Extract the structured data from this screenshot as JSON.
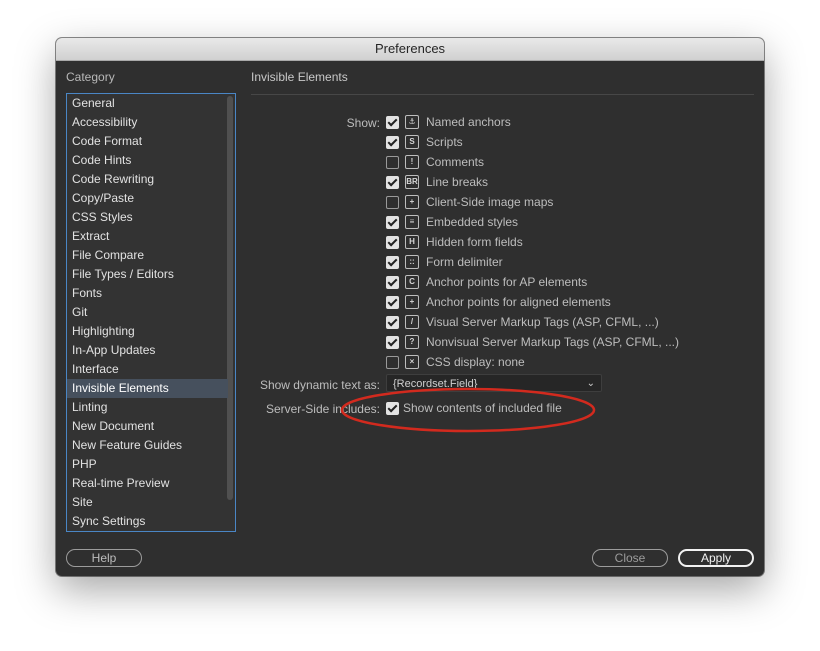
{
  "window": {
    "title": "Preferences"
  },
  "sidebar": {
    "heading": "Category",
    "items": [
      {
        "label": "General"
      },
      {
        "label": "Accessibility"
      },
      {
        "label": "Code Format"
      },
      {
        "label": "Code Hints"
      },
      {
        "label": "Code Rewriting"
      },
      {
        "label": "Copy/Paste"
      },
      {
        "label": "CSS Styles"
      },
      {
        "label": "Extract"
      },
      {
        "label": "File Compare"
      },
      {
        "label": "File Types / Editors"
      },
      {
        "label": "Fonts"
      },
      {
        "label": "Git"
      },
      {
        "label": "Highlighting"
      },
      {
        "label": "In-App Updates"
      },
      {
        "label": "Interface"
      },
      {
        "label": "Invisible Elements"
      },
      {
        "label": "Linting"
      },
      {
        "label": "New Document"
      },
      {
        "label": "New Feature Guides"
      },
      {
        "label": "PHP"
      },
      {
        "label": "Real-time Preview"
      },
      {
        "label": "Site"
      },
      {
        "label": "Sync Settings"
      }
    ],
    "selected": "Invisible Elements"
  },
  "panel": {
    "title": "Invisible Elements",
    "show_label": "Show:",
    "show_items": [
      {
        "label": "Named anchors",
        "checked": true,
        "icon": "anchor-icon"
      },
      {
        "label": "Scripts",
        "checked": true,
        "icon": "script-icon"
      },
      {
        "label": "Comments",
        "checked": false,
        "icon": "comment-icon"
      },
      {
        "label": "Line breaks",
        "checked": true,
        "icon": "line-break-icon"
      },
      {
        "label": "Client-Side image maps",
        "checked": false,
        "icon": "image-map-icon"
      },
      {
        "label": "Embedded styles",
        "checked": true,
        "icon": "embedded-style-icon"
      },
      {
        "label": "Hidden form fields",
        "checked": true,
        "icon": "hidden-field-icon"
      },
      {
        "label": "Form delimiter",
        "checked": true,
        "icon": "form-delimiter-icon"
      },
      {
        "label": "Anchor points for AP elements",
        "checked": true,
        "icon": "ap-anchor-icon"
      },
      {
        "label": "Anchor points for aligned elements",
        "checked": true,
        "icon": "aligned-anchor-icon"
      },
      {
        "label": "Visual Server Markup Tags (ASP, CFML, ...)",
        "checked": true,
        "icon": "visual-server-tag-icon"
      },
      {
        "label": "Nonvisual Server Markup Tags (ASP, CFML, ...)",
        "checked": true,
        "icon": "nonvisual-server-tag-icon"
      },
      {
        "label": "CSS display: none",
        "checked": false,
        "icon": "css-display-none-icon"
      }
    ],
    "dynamic_text_label": "Show dynamic text as:",
    "dynamic_text_value": "{Recordset.Field}",
    "ssi_label": "Server-Side includes:",
    "ssi_item": {
      "label": "Show contents of included file",
      "checked": true
    }
  },
  "buttons": {
    "help": "Help",
    "close": "Close",
    "apply": "Apply"
  },
  "colors": {
    "accent": "#4a86c5",
    "annotation": "#d22a1e",
    "panel_bg": "#2f2f2f"
  }
}
